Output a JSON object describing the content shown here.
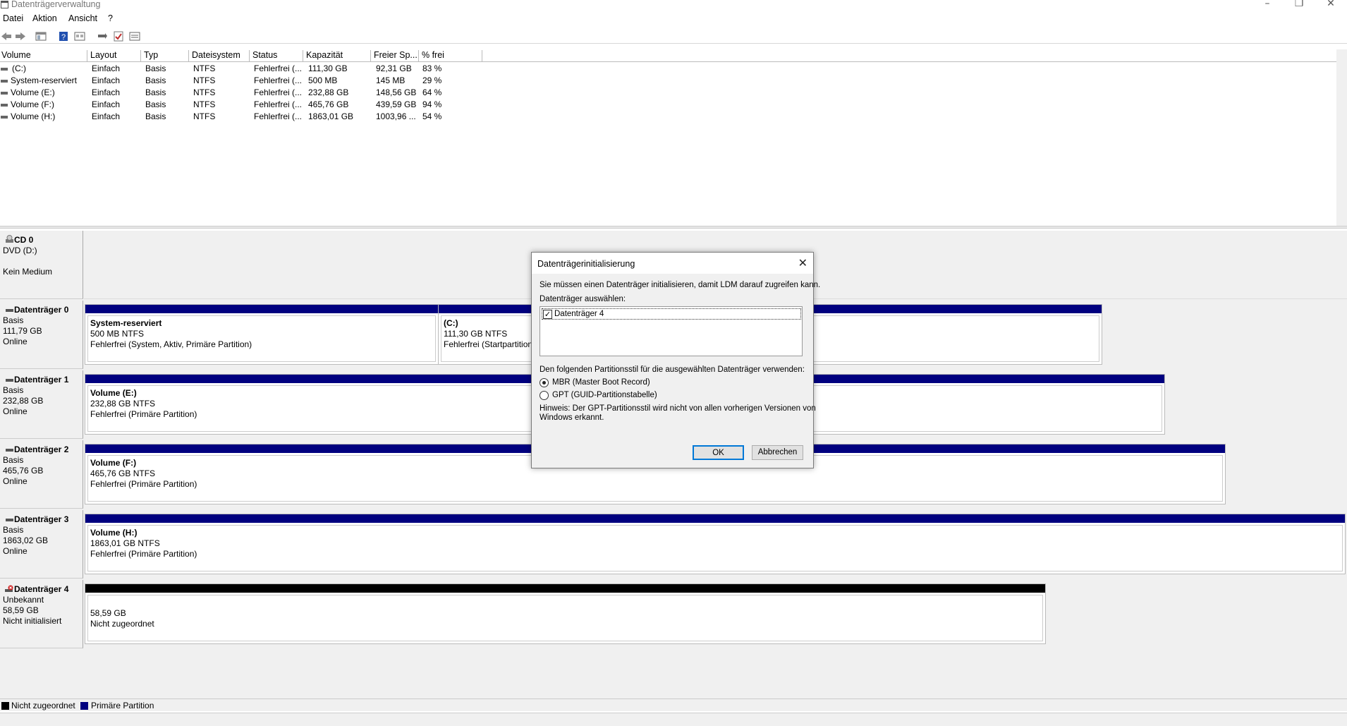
{
  "window": {
    "title": "Datenträgerverwaltung"
  },
  "menu": [
    "Datei",
    "Aktion",
    "Ansicht",
    "?"
  ],
  "toolbar": [
    "back-icon",
    "forward-icon",
    "console-tree-icon",
    "help-icon",
    "properties-icon",
    "connect-icon",
    "check-icon",
    "detail-icon"
  ],
  "volume_list": {
    "headers": [
      "Volume",
      "Layout",
      "Typ",
      "Dateisystem",
      "Status",
      "Kapazität",
      "Freier Sp...",
      "% frei"
    ],
    "rows": [
      [
        "(C:)",
        "Einfach",
        "Basis",
        "NTFS",
        "Fehlerfrei (...",
        "111,30 GB",
        "92,31 GB",
        "83 %"
      ],
      [
        "System-reserviert",
        "Einfach",
        "Basis",
        "NTFS",
        "Fehlerfrei (...",
        "500 MB",
        "145 MB",
        "29 %"
      ],
      [
        "Volume (E:)",
        "Einfach",
        "Basis",
        "NTFS",
        "Fehlerfrei (...",
        "232,88 GB",
        "148,56 GB",
        "64 %"
      ],
      [
        "Volume (F:)",
        "Einfach",
        "Basis",
        "NTFS",
        "Fehlerfrei (...",
        "465,76 GB",
        "439,59 GB",
        "94 %"
      ],
      [
        "Volume (H:)",
        "Einfach",
        "Basis",
        "NTFS",
        "Fehlerfrei (...",
        "1863,01 GB",
        "1003,96 ...",
        "54 %"
      ]
    ]
  },
  "disks": {
    "cd0": {
      "name": "CD 0",
      "l1": "DVD (D:)",
      "l2": "",
      "l3": "Kein Medium"
    },
    "d0": {
      "name": "Datenträger 0",
      "l1": "Basis",
      "l2": "111,79 GB",
      "l3": "Online"
    },
    "d1": {
      "name": "Datenträger 1",
      "l1": "Basis",
      "l2": "232,88 GB",
      "l3": "Online"
    },
    "d2": {
      "name": "Datenträger 2",
      "l1": "Basis",
      "l2": "465,76 GB",
      "l3": "Online"
    },
    "d3": {
      "name": "Datenträger 3",
      "l1": "Basis",
      "l2": "1863,02 GB",
      "l3": "Online"
    },
    "d4": {
      "name": "Datenträger 4",
      "l1": "Unbekannt",
      "l2": "58,59 GB",
      "l3": "Nicht initialisiert"
    }
  },
  "partitions": {
    "sysres": {
      "name": "System-reserviert",
      "size": "500 MB NTFS",
      "status": "Fehlerfrei (System, Aktiv, Primäre Partition)"
    },
    "c": {
      "name": "(C:)",
      "size": "111,30 GB NTFS",
      "status": "Fehlerfrei (Startpartition"
    },
    "e": {
      "name": "Volume  (E:)",
      "size": "232,88 GB NTFS",
      "status": "Fehlerfrei (Primäre Partition)"
    },
    "f": {
      "name": "Volume  (F:)",
      "size": "465,76 GB NTFS",
      "status": "Fehlerfrei (Primäre Partition)"
    },
    "h": {
      "name": "Volume  (H:)",
      "size": "1863,01 GB NTFS",
      "status": "Fehlerfrei (Primäre Partition)"
    },
    "unalloc": {
      "name": "",
      "size": "58,59 GB",
      "status": "Nicht zugeordnet"
    }
  },
  "legend": {
    "unallocated": "Nicht zugeordnet",
    "primary": "Primäre Partition",
    "unallocated_color": "#000000",
    "primary_color": "#00007f"
  },
  "dialog": {
    "title": "Datenträgerinitialisierung",
    "intro": "Sie müssen einen Datenträger initialisieren, damit LDM darauf zugreifen kann.",
    "select_label": "Datenträger auswählen:",
    "disk_item": "Datenträger 4",
    "disk_item_checked": true,
    "style_label": "Den folgenden Partitionsstil für die ausgewählten Datenträger verwenden:",
    "mbr": "MBR (Master Boot Record)",
    "gpt": "GPT (GUID-Partitionstabelle)",
    "selected_style": "MBR",
    "note_line1": "Hinweis: Der GPT-Partitionsstil wird nicht von allen vorherigen Versionen von",
    "note_line2": "Windows erkannt.",
    "ok": "OK",
    "cancel": "Abbrechen"
  }
}
